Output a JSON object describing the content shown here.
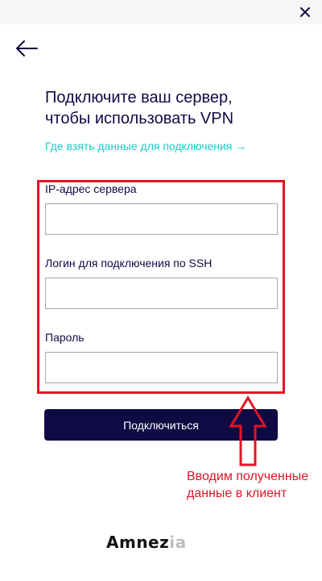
{
  "window": {
    "close_icon": "close-icon"
  },
  "nav": {
    "back_icon": "arrow-left-icon"
  },
  "title": {
    "line1": "Подключите ваш сервер,",
    "line2": "чтобы использовать VPN"
  },
  "help_link": {
    "label": "Где взять данные для подключения →",
    "color": "#15cdcb"
  },
  "form": {
    "fields": [
      {
        "label": "IP-адрес сервера",
        "value": "",
        "placeholder": ""
      },
      {
        "label": "Логин для подключения по SSH",
        "value": "",
        "placeholder": ""
      },
      {
        "label": "Пароль",
        "value": "",
        "placeholder": ""
      }
    ],
    "submit_label": "Подключиться"
  },
  "annotation": {
    "text": "Вводим полученные данные в клиент",
    "color": "#e01425"
  },
  "logo": {
    "text_main": "Amnez",
    "text_fade": "ia"
  },
  "colors": {
    "primary": "#100a44",
    "accent": "#15cdcb",
    "highlight": "#e01425"
  }
}
